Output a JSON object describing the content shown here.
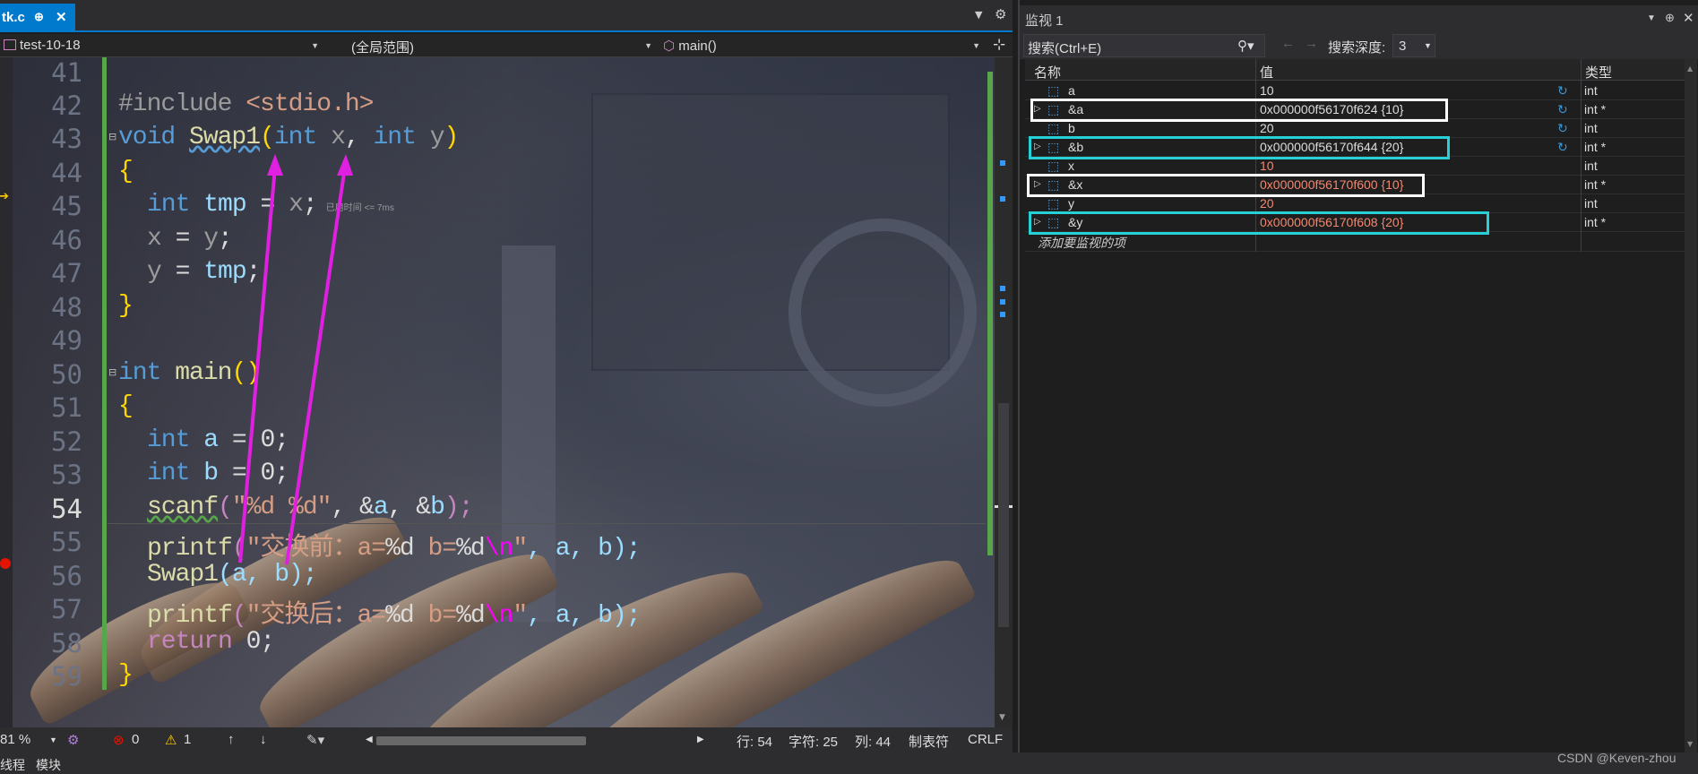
{
  "editor": {
    "tab_label": "tk.c",
    "tab_pin": "⊕",
    "tab_close": "✕",
    "nav": {
      "project": "test-10-18",
      "scope": "(全局范围)",
      "function": "main()"
    },
    "lines": [
      {
        "n": "41"
      },
      {
        "n": "42"
      },
      {
        "n": "43"
      },
      {
        "n": "44"
      },
      {
        "n": "45"
      },
      {
        "n": "46"
      },
      {
        "n": "47"
      },
      {
        "n": "48"
      },
      {
        "n": "49"
      },
      {
        "n": "50"
      },
      {
        "n": "51"
      },
      {
        "n": "52"
      },
      {
        "n": "53"
      },
      {
        "n": "54"
      },
      {
        "n": "55"
      },
      {
        "n": "56"
      },
      {
        "n": "57"
      },
      {
        "n": "58"
      },
      {
        "n": "59"
      }
    ],
    "code": {
      "l42_a": "#include ",
      "l42_b": "<stdio.h>",
      "l43_a": "void ",
      "l43_b": "Swap1",
      "l43_c": "(",
      "l43_d": "int ",
      "l43_e": "x",
      ", ": ", ",
      "l43_f": "int ",
      "l43_g": "y",
      "l43_h": ")",
      "l44": "{",
      "l45_a": "int ",
      "l45_b": "tmp",
      " eq": " = ",
      "l45_c": "x",
      ";": ";",
      "l45_hint": "已用时间 <= 7ms",
      "l46_a": "x",
      " =": " = ",
      "l46_b": "y",
      "l47_a": "y",
      "l47_b": "tmp",
      "l48": "}",
      "l50_a": "int ",
      "l50_b": "main",
      "l50_c": "()",
      "l51": "{",
      "l52_a": "int ",
      "l52_b": "a",
      " = 0": " = 0;",
      "l53_a": "int ",
      "l53_b": "b",
      "l54_a": "scanf",
      "l54_b": "(",
      "l54_c": "\"%d %d\"",
      "l54_d": ", &",
      "l54_e": "a",
      "l54_f": ", &",
      "l54_g": "b",
      "l54_h": ");",
      "l55_a": "printf",
      "l55_b": "(",
      "l55_c": "\"交换前：a=",
      "l55_d": "%d",
      "l55_e": " b=",
      "l55_f": "%d",
      "l55_g": "\\n",
      "l55_h": "\"",
      ", a, b": ", a, b);",
      "l56_a": "Swap1",
      "l56_b": "(a, b);",
      "l57_c": "\"交换后：a=",
      "l58_a": "return ",
      "l58_b": "0;",
      "l59": "}"
    },
    "status": {
      "zoom": "81 %",
      "errors": "0",
      "warnings": "1",
      "row": "行: 54",
      "char": "字符: 25",
      "col": "列: 44",
      "tabs": "制表符",
      "eol": "CRLF"
    }
  },
  "bottom_tabs": [
    "线程",
    "模块"
  ],
  "watch": {
    "title": "监视 1",
    "search_placeholder": "搜索(Ctrl+E)",
    "depth_label": "搜索深度:",
    "depth_value": "3",
    "columns": {
      "name": "名称",
      "value": "值",
      "type": "类型"
    },
    "rows": [
      {
        "name": "a",
        "value": "10",
        "type": "int",
        "expand": "",
        "refresh": "↻"
      },
      {
        "name": "&a",
        "value": "0x000000f56170f624 {10}",
        "type": "int *",
        "expand": "▷",
        "refresh": "↻"
      },
      {
        "name": "b",
        "value": "20",
        "type": "int",
        "expand": "",
        "refresh": "↻"
      },
      {
        "name": "&b",
        "value": "0x000000f56170f644 {20}",
        "type": "int *",
        "expand": "▷",
        "refresh": "↻"
      },
      {
        "name": "x",
        "value": "10",
        "type": "int",
        "expand": "",
        "refresh": ""
      },
      {
        "name": "&x",
        "value": "0x000000f56170f600 {10}",
        "type": "int *",
        "expand": "▷",
        "refresh": ""
      },
      {
        "name": "y",
        "value": "20",
        "type": "int",
        "expand": "",
        "refresh": ""
      },
      {
        "name": "&y",
        "value": "0x000000f56170f608 {20}",
        "type": "int *",
        "expand": "▷",
        "refresh": ""
      }
    ],
    "add_placeholder": "添加要监视的项"
  },
  "footer": "CSDN @Keven-zhou"
}
